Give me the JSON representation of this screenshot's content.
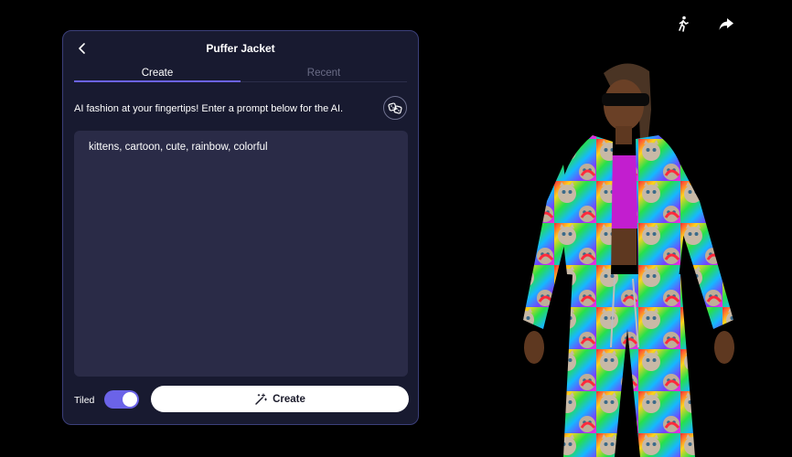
{
  "panel": {
    "title": "Puffer Jacket",
    "back_icon": "chevron-left-icon"
  },
  "tabs": [
    {
      "label": "Create",
      "active": true
    },
    {
      "label": "Recent",
      "active": false
    }
  ],
  "intro_text": "AI fashion at your fingertips! Enter a prompt below for the AI.",
  "dice_icon": "dice-icon",
  "prompt": {
    "value": "kittens, cartoon, cute, rainbow, colorful"
  },
  "tiled": {
    "label": "Tiled",
    "enabled": true
  },
  "create_button": {
    "label": "Create",
    "icon": "magic-wand-icon"
  },
  "top_icons": [
    "walking-figure-icon",
    "share-arrow-icon"
  ],
  "colors": {
    "accent": "#6b63e8",
    "panel_bg": "#181a30",
    "panel_border": "#3b3f7a",
    "prompt_bg": "#2a2b47"
  }
}
